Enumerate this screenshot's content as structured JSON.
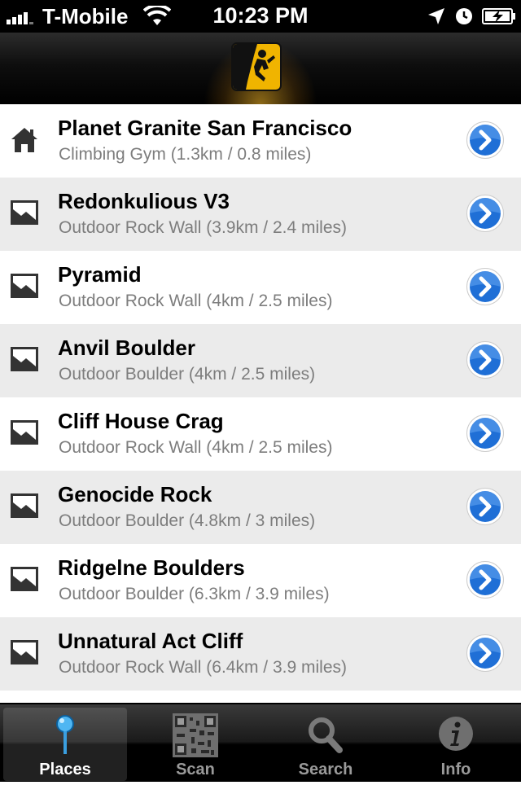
{
  "status_bar": {
    "carrier": "T-Mobile",
    "time": "10:23 PM",
    "icons": [
      "signal-icon",
      "wifi-icon",
      "location-arrow-icon",
      "alarm-clock-icon",
      "battery-charging-icon"
    ]
  },
  "navbar": {
    "logo_icon": "climber-logo-icon",
    "accent": "#f0b400"
  },
  "places": [
    {
      "icon": "home-icon",
      "title": "Planet Granite San Francisco",
      "subtitle": "Climbing Gym (1.3km / 0.8 miles)"
    },
    {
      "icon": "image-icon",
      "title": "Redonkulious V3",
      "subtitle": "Outdoor Rock Wall (3.9km / 2.4 miles)"
    },
    {
      "icon": "image-icon",
      "title": "Pyramid",
      "subtitle": "Outdoor Rock Wall (4km / 2.5 miles)"
    },
    {
      "icon": "image-icon",
      "title": "Anvil Boulder",
      "subtitle": "Outdoor Boulder (4km / 2.5 miles)"
    },
    {
      "icon": "image-icon",
      "title": "Cliff House Crag",
      "subtitle": "Outdoor Rock Wall (4km / 2.5 miles)"
    },
    {
      "icon": "image-icon",
      "title": "Genocide Rock",
      "subtitle": "Outdoor Boulder (4.8km / 3 miles)"
    },
    {
      "icon": "image-icon",
      "title": "Ridgelne Boulders",
      "subtitle": "Outdoor Boulder (6.3km / 3.9 miles)"
    },
    {
      "icon": "image-icon",
      "title": "Unnatural Act Cliff",
      "subtitle": "Outdoor Rock Wall (6.4km / 3.9 miles)"
    }
  ],
  "disclosure_color": "#1f6fd6",
  "tabbar": {
    "tabs": [
      {
        "label": "Places",
        "icon": "map-pin-icon",
        "active": true
      },
      {
        "label": "Scan",
        "icon": "qr-code-icon",
        "active": false
      },
      {
        "label": "Search",
        "icon": "search-icon",
        "active": false
      },
      {
        "label": "Info",
        "icon": "info-icon",
        "active": false
      }
    ]
  }
}
